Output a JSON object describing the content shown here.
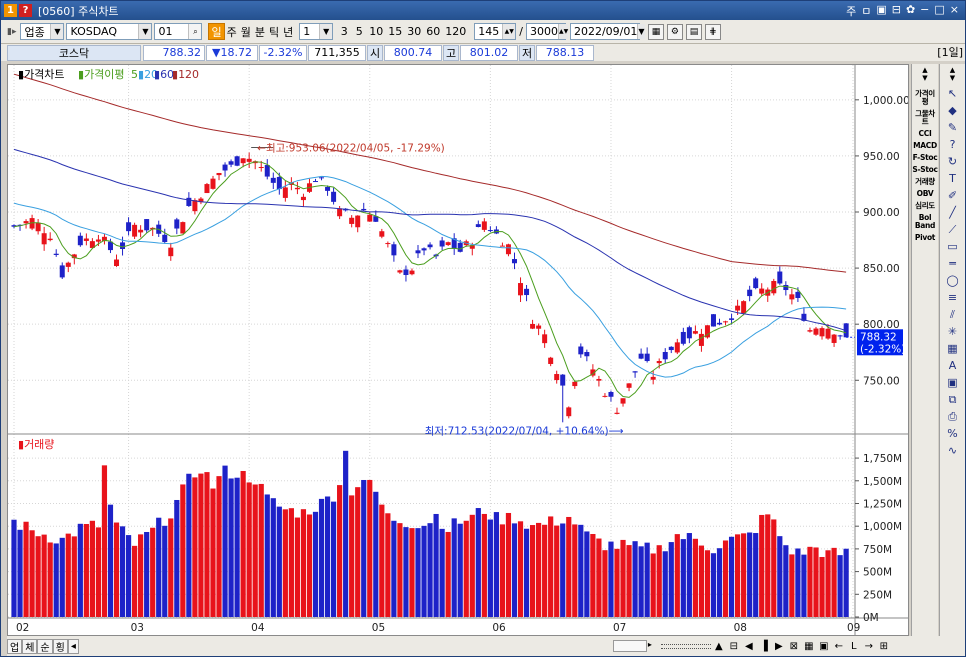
{
  "window": {
    "title": "[0560] 주식차트",
    "icon_1": "1",
    "icon_2": "?"
  },
  "titlebar_buttons": [
    "주",
    "ㅁ",
    "▣",
    "⊟",
    "✿",
    "−",
    "□",
    "×"
  ],
  "toolbar": {
    "market": "업종",
    "symbol": "KOSDAQ",
    "code": "01",
    "timeframes": [
      "일",
      "주",
      "월",
      "분",
      "틱",
      "년"
    ],
    "timeframe_selected": "일",
    "minute_value": "1",
    "intervals": [
      "3",
      "5",
      "10",
      "15",
      "30",
      "60",
      "120"
    ],
    "count": "145",
    "total": "3000",
    "date": "2022/09/01"
  },
  "info": {
    "name": "코스닥",
    "price": "788.32",
    "change": "▼18.72",
    "rate": "-2.32%",
    "volume": "711,355",
    "open_label": "시",
    "open": "800.74",
    "high_label": "고",
    "high": "801.02",
    "low_label": "저",
    "low": "788.13",
    "period": "[1일]"
  },
  "price_legend": {
    "main": "가격차트",
    "ma_label": "가격이평",
    "ma5": "5",
    "ma20": "20",
    "ma60": "60",
    "ma120": "120"
  },
  "volume_legend": "거래량",
  "colors": {
    "up": "#e8131b",
    "down": "#1e22c8",
    "ma5": "#4b9e1e",
    "ma20": "#3aa0e0",
    "ma60": "#2a33b0",
    "ma120": "#a52a2a",
    "current": "#0022ee"
  },
  "price_axis": {
    "ticks": [
      "1,000.00",
      "950.00",
      "900.00",
      "850.00",
      "800.00",
      "750.00"
    ],
    "tick_values": [
      1000,
      950,
      900,
      850,
      800,
      750
    ],
    "range": [
      703,
      1015
    ]
  },
  "current_label": {
    "price": "788.32",
    "rate": "(-2.32%)"
  },
  "volume_axis": {
    "ticks": [
      "1,750M",
      "1,500M",
      "1,250M",
      "1,000M",
      "750M",
      "500M",
      "250M",
      "0M"
    ],
    "tick_values": [
      1750,
      1500,
      1250,
      1000,
      750,
      500,
      250,
      0
    ],
    "range": [
      0,
      1850
    ]
  },
  "x_axis": {
    "months": [
      "02",
      "03",
      "04",
      "05",
      "06",
      "07",
      "08",
      "09"
    ],
    "month_index": [
      0,
      19,
      39,
      59,
      79,
      99,
      119,
      138
    ]
  },
  "annotations": {
    "high": "최고:953.06(2022/04/05, -17.29%)",
    "low": "최저:712.53(2022/07/04, +10.64%)"
  },
  "chart_data": {
    "type": "candlestick",
    "series": [
      {
        "name": "가격차트",
        "anchors": [
          [
            0,
            887
          ],
          [
            3,
            893
          ],
          [
            6,
            880
          ],
          [
            8,
            845
          ],
          [
            11,
            873
          ],
          [
            14,
            880
          ],
          [
            17,
            860
          ],
          [
            20,
            888
          ],
          [
            23,
            885
          ],
          [
            26,
            873
          ],
          [
            29,
            905
          ],
          [
            32,
            922
          ],
          [
            34,
            935
          ],
          [
            36,
            940
          ],
          [
            38,
            951
          ],
          [
            40,
            945
          ],
          [
            42,
            932
          ],
          [
            44,
            920
          ],
          [
            46,
            925
          ],
          [
            48,
            918
          ],
          [
            50,
            930
          ],
          [
            52,
            922
          ],
          [
            54,
            900
          ],
          [
            56,
            895
          ],
          [
            58,
            902
          ],
          [
            60,
            895
          ],
          [
            62,
            870
          ],
          [
            64,
            845
          ],
          [
            66,
            850
          ],
          [
            68,
            868
          ],
          [
            70,
            860
          ],
          [
            72,
            872
          ],
          [
            74,
            865
          ],
          [
            76,
            875
          ],
          [
            78,
            892
          ],
          [
            80,
            880
          ],
          [
            82,
            870
          ],
          [
            84,
            840
          ],
          [
            86,
            805
          ],
          [
            88,
            790
          ],
          [
            90,
            760
          ],
          [
            92,
            730
          ],
          [
            94,
            775
          ],
          [
            96,
            760
          ],
          [
            98,
            740
          ],
          [
            100,
            725
          ],
          [
            102,
            745
          ],
          [
            104,
            770
          ],
          [
            106,
            755
          ],
          [
            108,
            772
          ],
          [
            110,
            785
          ],
          [
            112,
            790
          ],
          [
            114,
            795
          ],
          [
            116,
            800
          ],
          [
            118,
            805
          ],
          [
            120,
            812
          ],
          [
            122,
            825
          ],
          [
            124,
            830
          ],
          [
            126,
            834
          ],
          [
            128,
            832
          ],
          [
            130,
            820
          ],
          [
            132,
            795
          ],
          [
            134,
            800
          ],
          [
            136,
            795
          ],
          [
            138,
            788
          ]
        ]
      },
      {
        "name": "5",
        "color": "ma5"
      },
      {
        "name": "20",
        "color": "ma20"
      },
      {
        "name": "60",
        "color": "ma60"
      },
      {
        "name": "120",
        "color": "ma120"
      },
      {
        "name": "거래량"
      }
    ],
    "volume_anchors": [
      [
        0,
        1050
      ],
      [
        3,
        950
      ],
      [
        8,
        850
      ],
      [
        11,
        980
      ],
      [
        14,
        1010
      ],
      [
        15,
        1450
      ],
      [
        17,
        1000
      ],
      [
        20,
        800
      ],
      [
        23,
        950
      ],
      [
        26,
        1150
      ],
      [
        29,
        1500
      ],
      [
        31,
        1650
      ],
      [
        33,
        1450
      ],
      [
        35,
        1600
      ],
      [
        37,
        1580
      ],
      [
        40,
        1520
      ],
      [
        42,
        1300
      ],
      [
        45,
        1180
      ],
      [
        48,
        1150
      ],
      [
        51,
        1250
      ],
      [
        53,
        1350
      ],
      [
        55,
        1650
      ],
      [
        56,
        1400
      ],
      [
        58,
        1520
      ],
      [
        60,
        1370
      ],
      [
        62,
        1100
      ],
      [
        65,
        1050
      ],
      [
        68,
        1020
      ],
      [
        70,
        1120
      ],
      [
        72,
        980
      ],
      [
        74,
        1050
      ],
      [
        76,
        1100
      ],
      [
        78,
        1180
      ],
      [
        80,
        1080
      ],
      [
        83,
        1100
      ],
      [
        86,
        1000
      ],
      [
        89,
        1040
      ],
      [
        92,
        1100
      ],
      [
        95,
        900
      ],
      [
        98,
        800
      ],
      [
        101,
        780
      ],
      [
        104,
        750
      ],
      [
        107,
        750
      ],
      [
        110,
        900
      ],
      [
        113,
        850
      ],
      [
        116,
        760
      ],
      [
        119,
        850
      ],
      [
        122,
        900
      ],
      [
        125,
        1150
      ],
      [
        128,
        780
      ],
      [
        130,
        700
      ],
      [
        133,
        760
      ],
      [
        135,
        690
      ],
      [
        138,
        700
      ]
    ],
    "volume_spikes": [
      [
        15,
        1670
      ],
      [
        55,
        1830
      ],
      [
        125,
        1130
      ]
    ],
    "candles": 139,
    "last": {
      "close": 788.32,
      "open": 800.74,
      "high": 801.02,
      "low": 788.13
    },
    "extremes": {
      "high": {
        "value": 953.06,
        "date": "2022/04/05"
      },
      "low": {
        "value": 712.53,
        "date": "2022/07/04"
      }
    },
    "xlabel": "",
    "ylabel": "",
    "ylim": [
      703,
      1015
    ],
    "volume_ylim": [
      0,
      1850
    ]
  },
  "right_indicators": [
    "가격이평",
    "그물차트",
    "CCI",
    "MACD",
    "F-Stoc",
    "S-Stoc",
    "거래량",
    "OBV",
    "심리도",
    "Bol Band",
    "Pivot"
  ],
  "tools": [
    "cursor-icon",
    "eraser-icon",
    "pencil-icon",
    "help-icon",
    "refresh-icon",
    "text-icon",
    "brush-icon",
    "line-icon",
    "diag-icon",
    "rect-icon",
    "hline-icon",
    "ellipse-icon",
    "fibo-icon",
    "channel-icon",
    "gann-icon",
    "grid-icon",
    "auto-icon",
    "window-icon",
    "copy-icon",
    "print-icon",
    "percent-icon",
    "cycle-icon"
  ],
  "bottom": {
    "labels": [
      "업",
      "체",
      "순",
      "횡"
    ],
    "arrow": "◂"
  }
}
